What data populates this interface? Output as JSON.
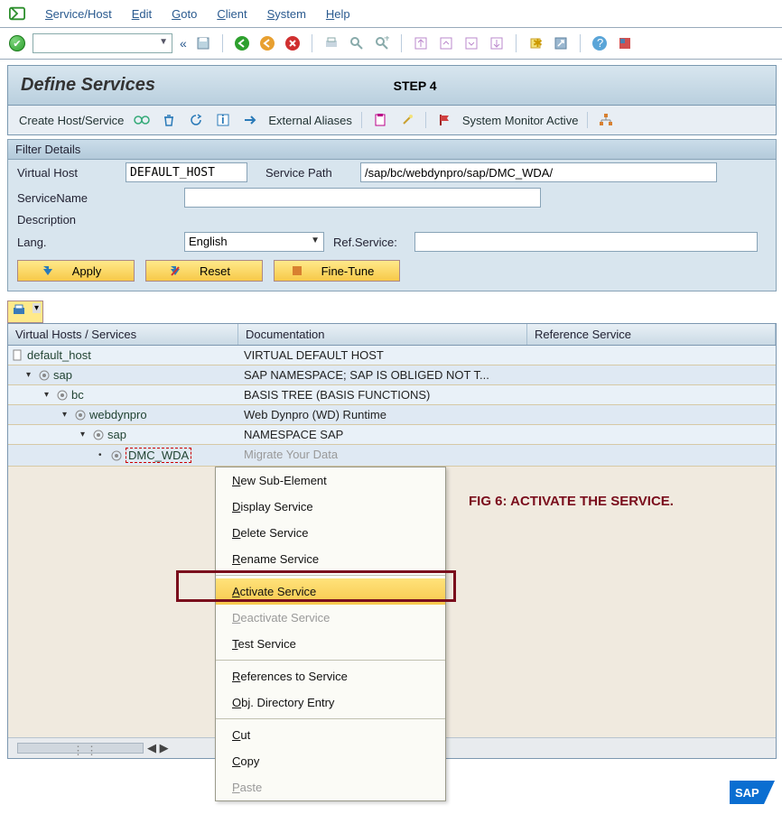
{
  "menubar": {
    "items": [
      {
        "l": "S",
        "r": "ervice/Host"
      },
      {
        "l": "E",
        "r": "dit"
      },
      {
        "l": "G",
        "r": "oto"
      },
      {
        "l": "C",
        "r": "lient"
      },
      {
        "l": "S",
        "r": "ystem"
      },
      {
        "l": "H",
        "r": "elp"
      }
    ]
  },
  "title": {
    "main": "Define Services",
    "step": "STEP 4"
  },
  "actionbar": {
    "create": "Create Host/Service",
    "external": "External Aliases",
    "monitor": "System Monitor Active"
  },
  "filter": {
    "panel_label": "Filter Details",
    "virtual_host_label": "Virtual Host",
    "virtual_host_value": "DEFAULT_HOST",
    "service_path_label": "Service Path",
    "service_path_value": "/sap/bc/webdynpro/sap/DMC_WDA/",
    "service_name_label": "ServiceName",
    "service_name_value": "",
    "description_label": "Description",
    "description_value": "",
    "lang_label": "Lang.",
    "lang_value": "English",
    "ref_service_label": "Ref.Service:",
    "ref_service_value": "",
    "apply": "Apply",
    "reset": "Reset",
    "fine": "Fine-Tune"
  },
  "table": {
    "headers": {
      "c1": "Virtual Hosts / Services",
      "c2": "Documentation",
      "c3": "Reference Service"
    },
    "rows": [
      {
        "indent": 0,
        "caret": "",
        "icon": "page",
        "label": "default_host",
        "doc": "VIRTUAL DEFAULT HOST"
      },
      {
        "indent": 1,
        "caret": "▾",
        "icon": "comp",
        "label": "sap",
        "doc": "SAP NAMESPACE; SAP IS OBLIGED NOT T..."
      },
      {
        "indent": 2,
        "caret": "▾",
        "icon": "comp",
        "label": "bc",
        "doc": "BASIS TREE (BASIS FUNCTIONS)"
      },
      {
        "indent": 3,
        "caret": "▾",
        "icon": "comp",
        "label": "webdynpro",
        "doc": "Web Dynpro (WD) Runtime"
      },
      {
        "indent": 4,
        "caret": "▾",
        "icon": "comp",
        "label": "sap",
        "doc": "NAMESPACE SAP"
      },
      {
        "indent": 5,
        "caret": "•",
        "icon": "comp-sel",
        "label": "DMC_WDA",
        "doc": "Migrate Your Data"
      }
    ]
  },
  "context_menu": {
    "items": [
      {
        "u": "N",
        "rest": "ew Sub-Element",
        "disabled": false,
        "hi": false
      },
      {
        "u": "D",
        "rest": "isplay Service",
        "disabled": false,
        "hi": false
      },
      {
        "u": "D",
        "rest": "elete Service",
        "disabled": false,
        "hi": false
      },
      {
        "u": "R",
        "rest": "ename Service",
        "disabled": false,
        "hi": false
      },
      {
        "sep": true
      },
      {
        "u": "A",
        "rest": "ctivate Service",
        "disabled": false,
        "hi": true
      },
      {
        "u": "D",
        "rest": "eactivate Service",
        "disabled": true,
        "hi": false
      },
      {
        "u": "T",
        "rest": "est Service",
        "disabled": false,
        "hi": false
      },
      {
        "sep": true
      },
      {
        "u": "R",
        "rest": "eferences to Service",
        "disabled": false,
        "hi": false
      },
      {
        "u": "O",
        "rest": "bj. Directory Entry",
        "disabled": false,
        "hi": false
      },
      {
        "sep": true
      },
      {
        "u": "C",
        "rest": "ut",
        "disabled": false,
        "hi": false
      },
      {
        "u": "C",
        "rest": "opy",
        "disabled": false,
        "hi": false
      },
      {
        "u": "P",
        "rest": "aste",
        "disabled": true,
        "hi": false
      }
    ]
  },
  "annotation": "FIG 6: ACTIVATE THE SERVICE.",
  "logo": "SAP"
}
